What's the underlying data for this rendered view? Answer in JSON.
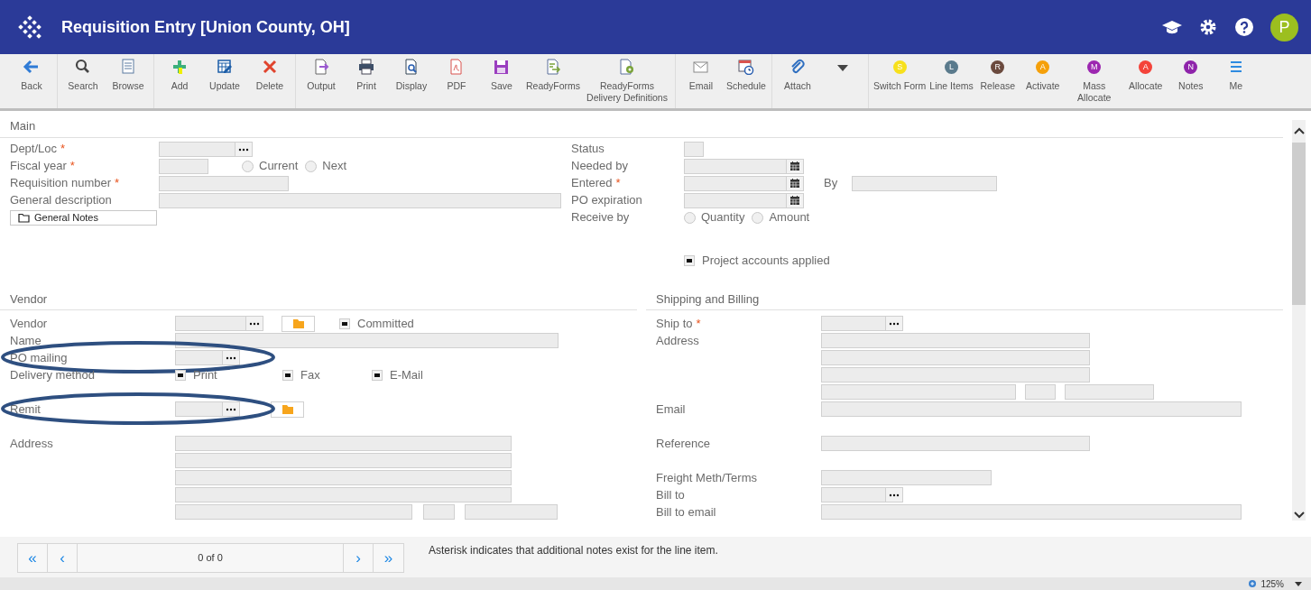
{
  "header": {
    "title": "Requisition Entry [Union County, OH]",
    "avatar": "P"
  },
  "toolbar": {
    "groups": [
      {
        "items": [
          {
            "kind": "icon",
            "label": "Back"
          }
        ]
      },
      {
        "items": [
          {
            "kind": "icon",
            "label": "Search"
          },
          {
            "kind": "icon",
            "label": "Browse"
          }
        ]
      },
      {
        "items": [
          {
            "kind": "icon",
            "label": "Add"
          },
          {
            "kind": "icon",
            "label": "Update"
          },
          {
            "kind": "icon",
            "label": "Delete"
          }
        ]
      },
      {
        "items": [
          {
            "kind": "icon",
            "label": "Output"
          },
          {
            "kind": "icon",
            "label": "Print"
          },
          {
            "kind": "icon",
            "label": "Display"
          },
          {
            "kind": "icon",
            "label": "PDF"
          },
          {
            "kind": "icon",
            "label": "Save"
          },
          {
            "kind": "icon",
            "label": "ReadyForms"
          },
          {
            "kind": "icon",
            "label": "ReadyForms Delivery Definitions"
          }
        ]
      },
      {
        "items": [
          {
            "kind": "icon",
            "label": "Email"
          },
          {
            "kind": "icon",
            "label": "Schedule"
          }
        ]
      },
      {
        "items": [
          {
            "kind": "icon",
            "label": "Attach"
          },
          {
            "kind": "dropdown"
          }
        ]
      },
      {
        "items": [
          {
            "kind": "badge",
            "badge": "S",
            "color": "#f7e01c",
            "label": "Switch Form"
          },
          {
            "kind": "badge",
            "badge": "L",
            "color": "#5a7a8c",
            "label": "Line Items"
          },
          {
            "kind": "badge",
            "badge": "R",
            "color": "#6b4a3e",
            "label": "Release"
          },
          {
            "kind": "badge",
            "badge": "A",
            "color": "#f5a00a",
            "label": "Activate"
          },
          {
            "kind": "badge",
            "badge": "M",
            "color": "#9c27b0",
            "label": "Mass Allocate"
          },
          {
            "kind": "badge",
            "badge": "A",
            "color": "#f4433a",
            "label": "Allocate"
          },
          {
            "kind": "badge",
            "badge": "N",
            "color": "#8e24aa",
            "label": "Notes"
          },
          {
            "kind": "icon",
            "label": "Me"
          }
        ]
      }
    ]
  },
  "main": {
    "title": "Main",
    "left": [
      {
        "label": "Dept/Loc",
        "marker": "*",
        "controls": [
          {
            "kind": "lookup"
          }
        ]
      },
      {
        "label": "Fiscal year",
        "marker": "*",
        "controls": [
          {
            "kind": "text"
          },
          {
            "kind": "radio",
            "label": "Current",
            "selected": false
          },
          {
            "kind": "radio",
            "label": "Next",
            "selected": false
          }
        ]
      },
      {
        "label": "Requisition number",
        "marker": "*",
        "controls": [
          {
            "kind": "text"
          }
        ]
      },
      {
        "label": "General description",
        "controls": [
          {
            "kind": "text"
          }
        ]
      },
      {
        "controls": [
          {
            "kind": "notes",
            "label": "General Notes"
          }
        ]
      }
    ],
    "right": [
      {
        "label": "Status",
        "controls": [
          {
            "kind": "text"
          }
        ]
      },
      {
        "label": "Needed by",
        "controls": [
          {
            "kind": "date"
          }
        ]
      },
      {
        "label": "Entered",
        "marker": "*",
        "controls": [
          {
            "kind": "date"
          },
          {
            "kind": "label",
            "label": "By"
          },
          {
            "kind": "text"
          }
        ]
      },
      {
        "label": "PO expiration",
        "controls": [
          {
            "kind": "date"
          }
        ]
      },
      {
        "label": "Receive by",
        "controls": [
          {
            "kind": "radio",
            "label": "Quantity",
            "selected": false
          },
          {
            "kind": "radio",
            "label": "Amount",
            "selected": false
          }
        ]
      },
      {
        "controls": [
          {
            "kind": "checkbox",
            "label": "Project accounts applied",
            "checked": true
          }
        ]
      }
    ]
  },
  "vendor": {
    "title": "Vendor",
    "rows": [
      {
        "label": "Vendor",
        "controls": [
          {
            "kind": "lookup"
          },
          {
            "kind": "folder"
          },
          {
            "kind": "checkbox",
            "label": "Committed",
            "checked": true
          }
        ]
      },
      {
        "label": "Name",
        "controls": [
          {
            "kind": "text"
          }
        ]
      },
      {
        "label": "PO mailing",
        "circled": true,
        "controls": [
          {
            "kind": "lookup"
          }
        ]
      },
      {
        "label": "Delivery method",
        "controls": [
          {
            "kind": "checkbox",
            "label": "Print",
            "checked": true
          },
          {
            "kind": "checkbox",
            "label": "Fax",
            "checked": true
          },
          {
            "kind": "checkbox",
            "label": "E-Mail",
            "checked": true
          }
        ]
      },
      {
        "label": "Remit",
        "circled": true,
        "controls": [
          {
            "kind": "lookup"
          },
          {
            "kind": "folder"
          }
        ]
      },
      {
        "label": "Address",
        "controls": [
          {
            "kind": "text"
          }
        ]
      },
      {
        "controls": [
          {
            "kind": "text"
          }
        ]
      },
      {
        "controls": [
          {
            "kind": "text"
          }
        ]
      },
      {
        "controls": [
          {
            "kind": "text"
          }
        ]
      },
      {
        "controls": [
          {
            "kind": "text"
          },
          {
            "kind": "text"
          },
          {
            "kind": "text"
          }
        ]
      }
    ]
  },
  "shipping": {
    "title": "Shipping and Billing",
    "rows": [
      {
        "label": "Ship to",
        "marker": "*",
        "controls": [
          {
            "kind": "lookup"
          }
        ]
      },
      {
        "label": "Address",
        "controls": [
          {
            "kind": "text"
          }
        ]
      },
      {
        "controls": [
          {
            "kind": "text"
          }
        ]
      },
      {
        "controls": [
          {
            "kind": "text"
          }
        ]
      },
      {
        "controls": [
          {
            "kind": "text"
          },
          {
            "kind": "text"
          },
          {
            "kind": "text"
          }
        ]
      },
      {
        "label": "Email",
        "controls": [
          {
            "kind": "text"
          }
        ]
      },
      {
        "label": "Reference",
        "controls": [
          {
            "kind": "text"
          }
        ]
      },
      {
        "label": "Freight Meth/Terms",
        "controls": [
          {
            "kind": "text"
          }
        ]
      },
      {
        "label": "Bill to",
        "controls": [
          {
            "kind": "lookup"
          }
        ]
      },
      {
        "label": "Bill to email",
        "controls": [
          {
            "kind": "text"
          }
        ]
      }
    ]
  },
  "pager": {
    "first": "«",
    "prev": "‹",
    "position": "0 of 0",
    "next": "›",
    "last": "»"
  },
  "note": "Asterisk indicates that additional notes exist for the line item.",
  "status_bar": {
    "zoom": "125%"
  }
}
